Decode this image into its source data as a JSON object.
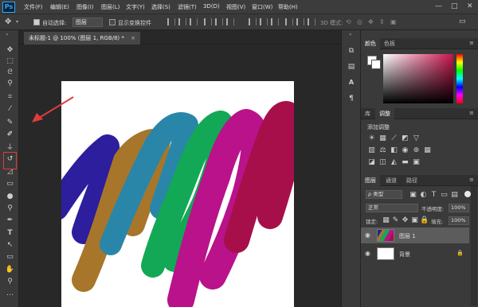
{
  "app": {
    "logo": "Ps"
  },
  "menu": [
    "文件(F)",
    "编辑(E)",
    "图像(I)",
    "图层(L)",
    "文字(Y)",
    "选择(S)",
    "滤镜(T)",
    "3D(D)",
    "视图(V)",
    "窗口(W)",
    "帮助(H)"
  ],
  "window_controls": {
    "minimize": "—",
    "maximize": "□",
    "close": "✕"
  },
  "options": {
    "auto_select_label": "自动选择:",
    "auto_select_value": "图层",
    "show_transform_label": "显示变换控件",
    "mode_3d_label": "3D 模式:"
  },
  "document": {
    "tab_title": "未标题-1 @ 100% (图层 1, RGB/8) *",
    "close": "×"
  },
  "tools": [
    {
      "name": "move-tool",
      "glyph": "✥"
    },
    {
      "name": "marquee-tool",
      "glyph": "⬚"
    },
    {
      "name": "lasso-tool",
      "glyph": "ᘓ"
    },
    {
      "name": "quick-select-tool",
      "glyph": "⚲"
    },
    {
      "name": "crop-tool",
      "glyph": "⌗"
    },
    {
      "name": "eyedropper-tool",
      "glyph": "⁄"
    },
    {
      "name": "spot-healing-tool",
      "glyph": "✎"
    },
    {
      "name": "brush-tool",
      "glyph": "✐"
    },
    {
      "name": "clone-stamp-tool",
      "glyph": "⏚"
    },
    {
      "name": "history-brush-tool",
      "glyph": "↺"
    },
    {
      "name": "eraser-tool",
      "glyph": "◿"
    },
    {
      "name": "gradient-tool",
      "glyph": "▭"
    },
    {
      "name": "blur-tool",
      "glyph": "●"
    },
    {
      "name": "dodge-tool",
      "glyph": "⚲"
    },
    {
      "name": "pen-tool",
      "glyph": "✒"
    },
    {
      "name": "type-tool",
      "glyph": "T"
    },
    {
      "name": "path-select-tool",
      "glyph": "↖"
    },
    {
      "name": "rectangle-tool",
      "glyph": "▭"
    },
    {
      "name": "hand-tool",
      "glyph": "✋"
    },
    {
      "name": "zoom-tool",
      "glyph": "⚲"
    },
    {
      "name": "more-tools",
      "glyph": "…"
    }
  ],
  "panels": {
    "color_tabs": [
      "颜色",
      "色板"
    ],
    "adjust_tabs": [
      "库",
      "调整"
    ],
    "adjust_title": "添加调整",
    "layers_tabs": [
      "图层",
      "通道",
      "路径"
    ],
    "filter_kind": "ρ 类型",
    "blend_mode": "正常",
    "opacity_label": "不透明度:",
    "opacity_value": "100%",
    "lock_label": "锁定:",
    "fill_label": "填充:",
    "fill_value": "100%",
    "layers": [
      {
        "name": "图层 1",
        "selected": true
      },
      {
        "name": "背景",
        "selected": false
      }
    ]
  },
  "colors": {
    "stroke_navy": "#2c1e9c",
    "stroke_bronze": "#a7762a",
    "stroke_teal": "#2a86a8",
    "stroke_green": "#13a855",
    "stroke_magenta": "#b9128a",
    "stroke_crimson": "#a70f4b",
    "annotation_red": "#e03b3b"
  }
}
